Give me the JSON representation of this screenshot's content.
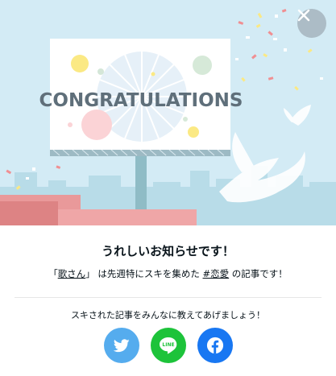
{
  "illustration": {
    "billboard_text": "CONGRATULATIONS"
  },
  "modal": {
    "close_icon": "close-icon",
    "headline": "うれしいお知らせです！",
    "detail": {
      "open_quote": "「",
      "author_link": "歌さん",
      "close_quote": "」",
      "middle_text": "は先週特にスキを集めた",
      "tag_link": "#恋愛",
      "tail_text": "の記事です！"
    },
    "share_prompt": "スキされた記事をみんなに教えてあげましょう！",
    "share": [
      {
        "network": "Twitter",
        "icon": "twitter-bird-icon",
        "color": "#55acee"
      },
      {
        "network": "LINE",
        "icon": "line-icon",
        "label": "LINE",
        "color": "#1dc33a"
      },
      {
        "network": "Facebook",
        "icon": "facebook-f-icon",
        "color": "#1877f2"
      }
    ]
  }
}
